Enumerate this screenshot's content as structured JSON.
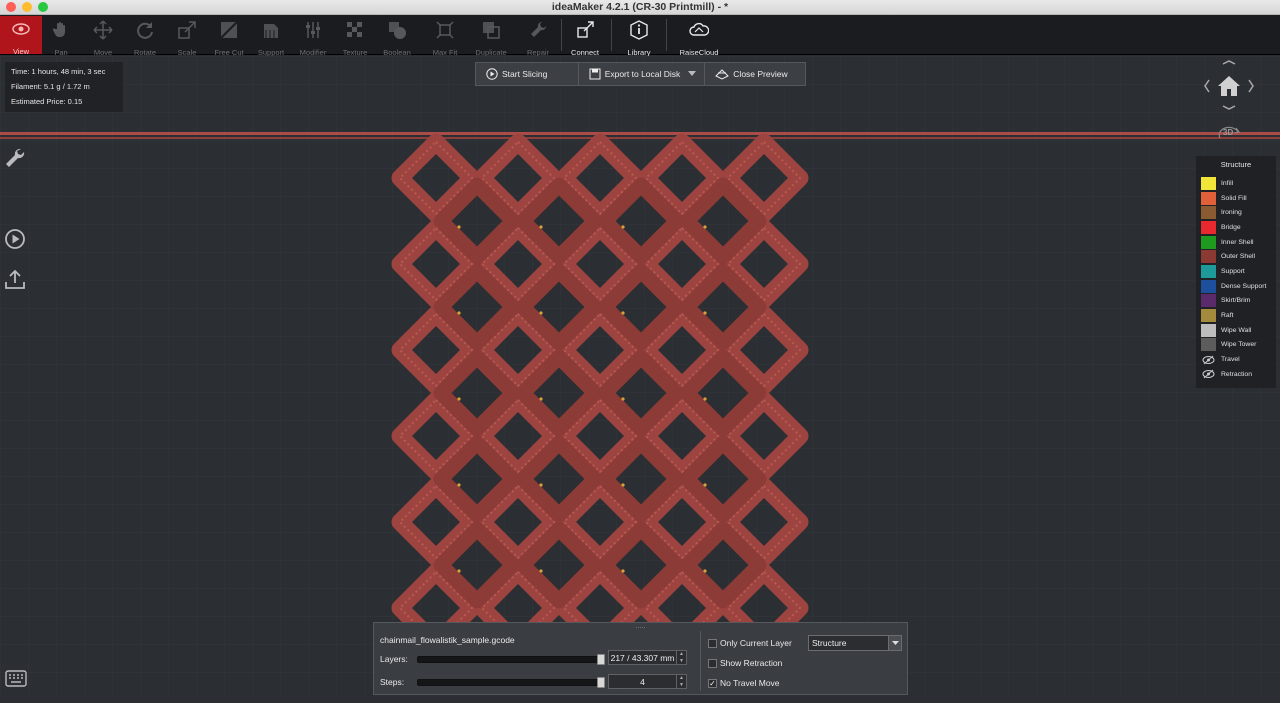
{
  "window": {
    "title": "ideaMaker 4.2.1 (CR-30 Printmill) - *"
  },
  "toolbar": {
    "items": [
      {
        "label": "View",
        "icon": "eye-icon"
      },
      {
        "label": "Pan",
        "icon": "hand-icon"
      },
      {
        "label": "Move",
        "icon": "move-icon"
      },
      {
        "label": "Rotate",
        "icon": "rotate-icon"
      },
      {
        "label": "Scale",
        "icon": "scale-icon"
      },
      {
        "label": "Free Cut",
        "icon": "cut-icon"
      },
      {
        "label": "Support",
        "icon": "support-icon"
      },
      {
        "label": "Modifier",
        "icon": "sliders-icon"
      },
      {
        "label": "Texture",
        "icon": "texture-icon"
      },
      {
        "label": "Boolean",
        "icon": "boolean-icon"
      },
      {
        "label": "Max Fit",
        "icon": "max-fit-icon"
      },
      {
        "label": "Duplicate",
        "icon": "duplicate-icon"
      },
      {
        "label": "Repair",
        "icon": "wrench-icon"
      },
      {
        "label": "Connect",
        "icon": "connect-icon"
      },
      {
        "label": "Library",
        "icon": "info-icon"
      },
      {
        "label": "RaiseCloud",
        "icon": "cloud-icon"
      }
    ]
  },
  "info": {
    "time": "Time: 1 hours, 48 min, 3 sec",
    "filament": "Filament: 5.1 g / 1.72 m",
    "price": "Estimated Price: 0.15"
  },
  "actions": {
    "start_slicing": "Start Slicing",
    "export": "Export to Local Disk",
    "close_preview": "Close Preview"
  },
  "view_badge": "3D",
  "legend": {
    "title": "Structure",
    "items": [
      {
        "label": "Infill",
        "color": "#f2e53a"
      },
      {
        "label": "Solid Fill",
        "color": "#e0603a"
      },
      {
        "label": "Ironing",
        "color": "#8a5a30"
      },
      {
        "label": "Bridge",
        "color": "#e8292e"
      },
      {
        "label": "Inner Shell",
        "color": "#1e9a1e"
      },
      {
        "label": "Outer Shell",
        "color": "#8a3a32"
      },
      {
        "label": "Support",
        "color": "#1f9a9a"
      },
      {
        "label": "Dense Support",
        "color": "#1c4f9c"
      },
      {
        "label": "Skirt/Brim",
        "color": "#5a2a6a"
      },
      {
        "label": "Raft",
        "color": "#a38a3c"
      },
      {
        "label": "Wipe Wall",
        "color": "#bdbdbd"
      },
      {
        "label": "Wipe Tower",
        "color": "#5c5c5c"
      }
    ],
    "toggles": [
      {
        "label": "Travel",
        "icon": "eye-hidden-icon"
      },
      {
        "label": "Retraction",
        "icon": "eye-hidden-icon"
      }
    ]
  },
  "preview": {
    "filename": "chainmail_flowalistik_sample.gcode",
    "layers_label": "Layers:",
    "layers_value": "217 / 43.307 mm",
    "layers_fraction": 1.0,
    "steps_label": "Steps:",
    "steps_value": "4",
    "steps_fraction": 1.0,
    "only_current_layer": {
      "label": "Only Current Layer",
      "checked": false
    },
    "show_retraction": {
      "label": "Show Retraction",
      "checked": false
    },
    "no_travel_move": {
      "label": "No Travel Move",
      "checked": true
    },
    "structure_select": "Structure"
  }
}
